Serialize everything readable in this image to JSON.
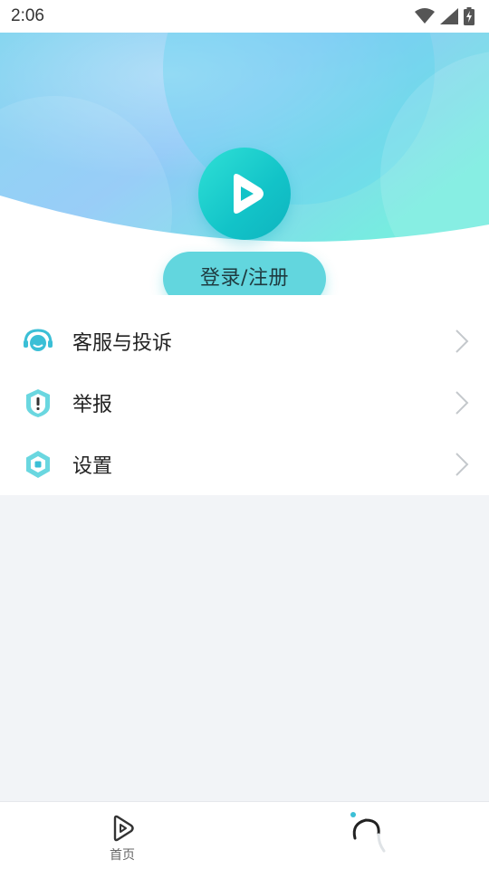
{
  "status_bar": {
    "time": "2:06",
    "icons": [
      "wifi-icon",
      "signal-icon",
      "battery-charging-icon"
    ]
  },
  "header": {
    "logo_icon": "play-icon",
    "login_label": "登录/注册",
    "colors": {
      "gradient_start": "#8fd8f5",
      "gradient_end": "#7be8e2",
      "accent": "#62d6de"
    }
  },
  "menu": {
    "items": [
      {
        "label": "客服与投诉",
        "icon": "headset-icon"
      },
      {
        "label": "举报",
        "icon": "report-shield-icon"
      },
      {
        "label": "设置",
        "icon": "settings-hexagon-icon"
      }
    ]
  },
  "bottom_nav": {
    "home_label": "首页",
    "home_icon": "play-outline-icon",
    "mine_icon": "profile-arc-icon"
  }
}
